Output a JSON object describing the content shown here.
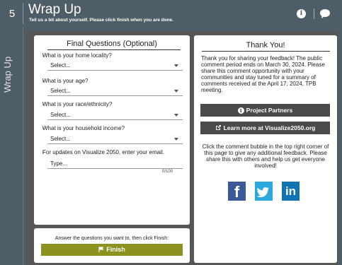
{
  "header": {
    "step_number": "5",
    "title": "Wrap Up",
    "subtitle": "Tell us a bit about yourself. Please click finish when you are done."
  },
  "side_tab": {
    "label": "Wrap Up"
  },
  "left_panel": {
    "title": "Final Questions (Optional)",
    "questions": [
      {
        "label": "What is your home locality?",
        "value": "Select..."
      },
      {
        "label": "What is your age?",
        "value": "Select..."
      },
      {
        "label": "What is your race/ethnicity?",
        "value": "Select..."
      },
      {
        "label": "What is your household income?",
        "value": "Select..."
      }
    ],
    "updates": {
      "label": "For updates on Visualize 2050, enter your email.",
      "placeholder": "Type...",
      "counter": "0/100"
    }
  },
  "finish_panel": {
    "note": "Answer the questions you want to, then click Finish:",
    "button_label": "Finish"
  },
  "right_panel": {
    "title": "Thank You!",
    "body": "Thank you for sharing your feedback! The public comment period ends on March 30, 2024. Please share this comment opportunity with your communities and stay tuned for a summary of comments received at the April 17, 2024, TPB meeting.",
    "partners_button": "Project Partners",
    "learn_more_button": "Learn more at Visualize2050.org",
    "help_text": "Click the comment bubble in the top right corner of this page to give any additional feedback. Please share this with others and help us get everyone involved!",
    "social": [
      {
        "icon": "facebook-icon",
        "label": "f"
      },
      {
        "icon": "twitter-icon",
        "label": ""
      },
      {
        "icon": "linkedin-icon",
        "label": "in"
      }
    ]
  },
  "colors": {
    "header_bg": "#4f5d66",
    "content_bg": "#565656",
    "finish_button": "#8c9220",
    "dark_button": "#4a4a4a",
    "facebook": "#3b5998",
    "twitter": "#2da7e0",
    "linkedin": "#1173b1"
  }
}
